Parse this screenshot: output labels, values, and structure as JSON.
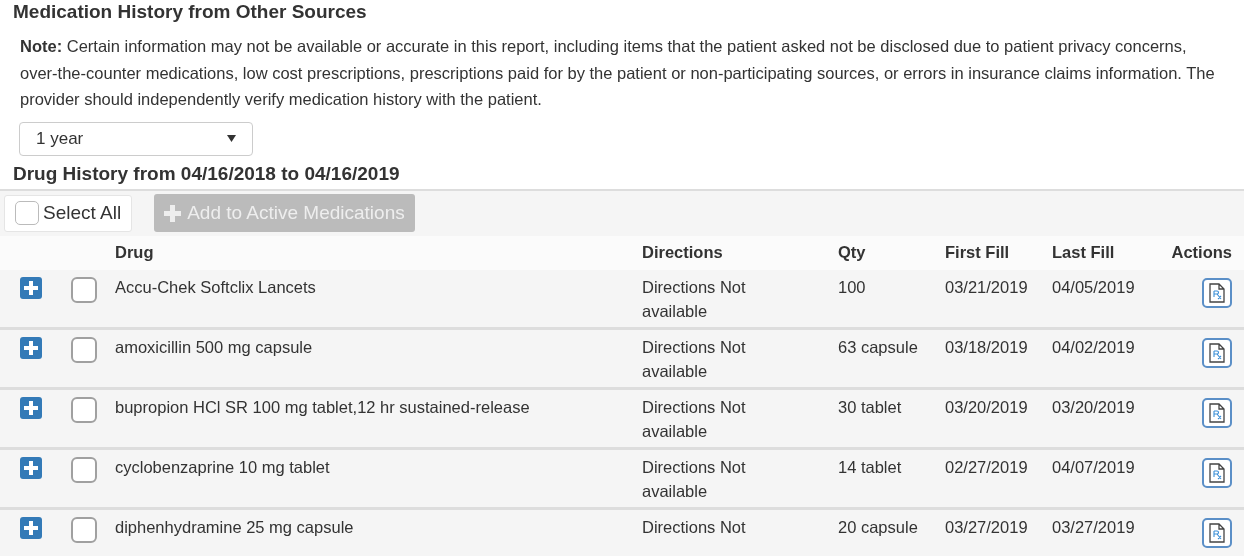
{
  "title": "Medication History from Other Sources",
  "note": "**Note:** Certain information may not be available or accurate in this report, including items that the patient asked not be disclosed due to patient privacy concerns, over-the-counter medications, low cost prescriptions, prescriptions paid for by the patient or non-participating sources, or errors in insurance claims information. The provider should independently verify medication history with the patient.",
  "period_select": {
    "value": "1 year"
  },
  "history_heading": "Drug History from 04/16/2018 to 04/16/2019",
  "toolbar": {
    "select_all": {
      "label": "Select All",
      "checked": false
    },
    "add_button": {
      "label": "Add to Active Medications",
      "disabled": true
    }
  },
  "table": {
    "columns": [
      "Drug",
      "Directions",
      "Qty",
      "First Fill",
      "Last Fill",
      "Actions"
    ],
    "rows": [
      {
        "checked": false,
        "drug": "Accu-Chek Softclix Lancets",
        "directions": "Directions Not available",
        "qty": "100",
        "first_fill": "03/21/2019",
        "last_fill": "04/05/2019"
      },
      {
        "checked": false,
        "drug": "amoxicillin 500 mg capsule",
        "directions": "Directions Not available",
        "qty": "63 capsule",
        "first_fill": "03/18/2019",
        "last_fill": "04/02/2019"
      },
      {
        "checked": false,
        "drug": "bupropion HCl SR 100 mg tablet,12 hr sustained-release",
        "directions": "Directions Not available",
        "qty": "30 tablet",
        "first_fill": "03/20/2019",
        "last_fill": "03/20/2019"
      },
      {
        "checked": false,
        "drug": "cyclobenzaprine 10 mg tablet",
        "directions": "Directions Not available",
        "qty": "14 tablet",
        "first_fill": "02/27/2019",
        "last_fill": "04/07/2019"
      },
      {
        "checked": false,
        "drug": "diphenhydramine 25 mg capsule",
        "directions": "Directions Not",
        "qty": "20 capsule",
        "first_fill": "03/27/2019",
        "last_fill": "03/27/2019"
      }
    ]
  }
}
